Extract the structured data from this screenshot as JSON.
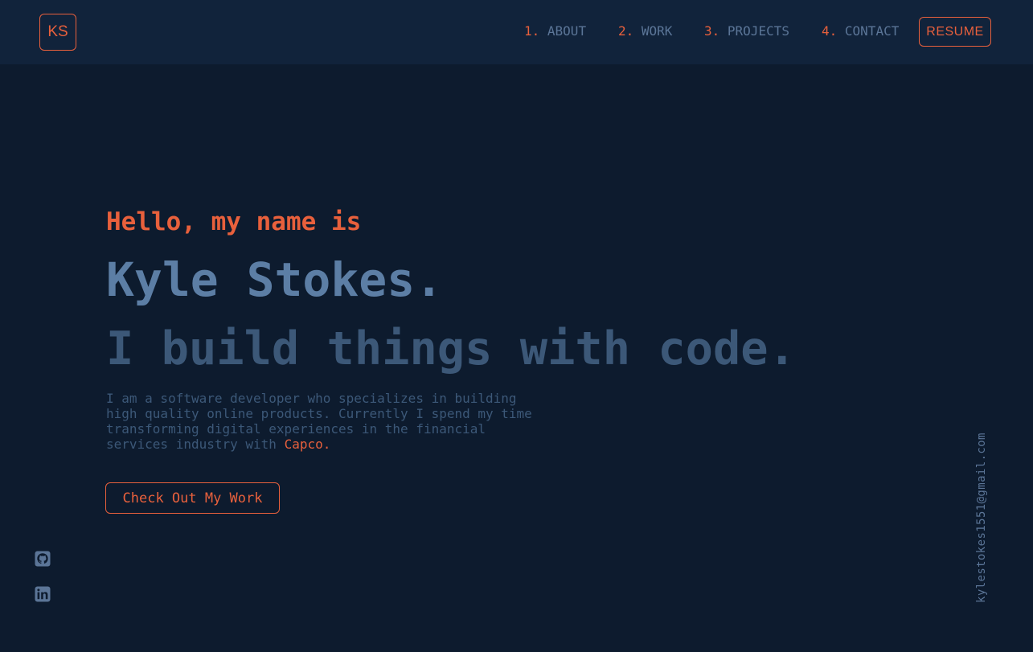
{
  "header": {
    "logo_text": "KS",
    "nav": [
      {
        "num": "1.",
        "label": "ABOUT"
      },
      {
        "num": "2.",
        "label": "WORK"
      },
      {
        "num": "3.",
        "label": "PROJECTS"
      },
      {
        "num": "4.",
        "label": "CONTACT"
      }
    ],
    "resume_label": "RESUME"
  },
  "hero": {
    "intro": "Hello, my name is",
    "name": "Kyle Stokes.",
    "tagline": "I build things with code.",
    "description_before": "I am a software developer who specializes in building high quality online products. Currently I spend my time transforming digital experiences in the financial services industry with ",
    "description_link": "Capco",
    "description_after": ".",
    "cta_label": "Check Out My Work"
  },
  "side": {
    "email": "kylestokes1551@gmail.com",
    "social_icons": [
      "github-icon",
      "linkedin-icon"
    ]
  },
  "colors": {
    "background": "#0d1b2e",
    "header": "#11233b",
    "accent": "#e8603c",
    "name": "#5c7ea5",
    "muted": "#3c5878"
  }
}
